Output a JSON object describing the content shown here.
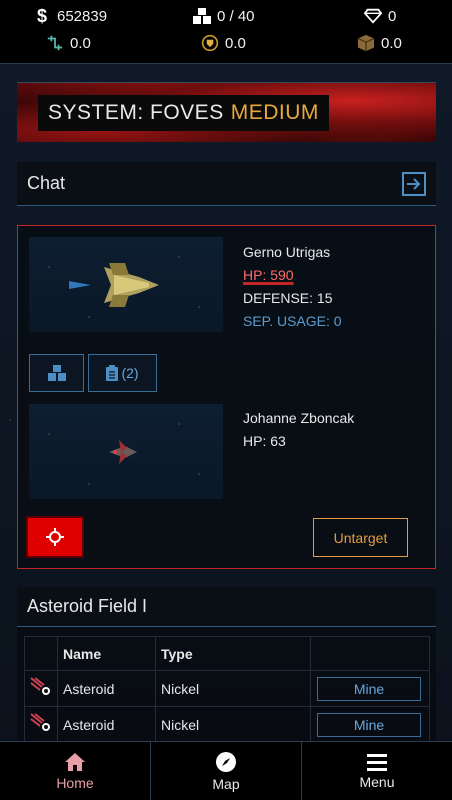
{
  "stats": {
    "credits": "652839",
    "cargo": "0 / 40",
    "gems": "0",
    "stat_a": "0.0",
    "stat_b": "0.0",
    "stat_c": "0.0"
  },
  "banner": {
    "prefix": "SYSTEM: FOVES",
    "level": "MEDIUM"
  },
  "chat": {
    "label": "Chat"
  },
  "combat": {
    "player": {
      "name": "Gerno Utrigas",
      "hp": "HP: 590",
      "defense": "DEFENSE: 15",
      "sep_usage": "SEP. USAGE: 0"
    },
    "cargo_btn_count": "(2)",
    "enemy": {
      "name": "Johanne Zboncak",
      "hp": "HP: 63"
    },
    "untarget_label": "Untarget"
  },
  "asteroid_field": {
    "title": "Asteroid Field I",
    "columns": [
      "Name",
      "Type",
      ""
    ],
    "rows": [
      {
        "name": "Asteroid",
        "type": "Nickel",
        "action": "Mine"
      },
      {
        "name": "Asteroid",
        "type": "Nickel",
        "action": "Mine"
      }
    ]
  },
  "nav": {
    "home": "Home",
    "map": "Map",
    "menu": "Menu"
  },
  "colors": {
    "accent_orange": "#e8a93c",
    "alert_red": "#e00000",
    "link_blue": "#5d9bd0"
  }
}
